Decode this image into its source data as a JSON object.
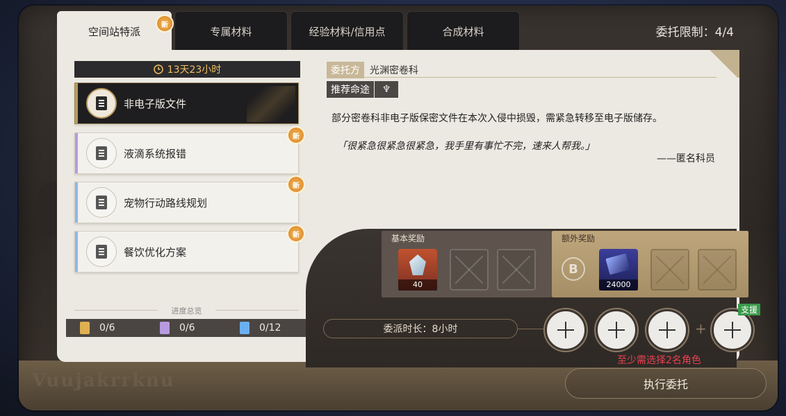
{
  "tabs": [
    {
      "label": "空间站特派",
      "badge": "新"
    },
    {
      "label": "专属材料"
    },
    {
      "label": "经验材料/信用点"
    },
    {
      "label": "合成材料"
    }
  ],
  "limit": "委托限制：4/4",
  "timer": "13天23小时",
  "tasks": [
    {
      "label": "非电子版文件"
    },
    {
      "label": "液滴系统报错",
      "badge": "新"
    },
    {
      "label": "宠物行动路线规划",
      "badge": "新"
    },
    {
      "label": "餐饮优化方案",
      "badge": "新"
    }
  ],
  "progress": {
    "title": "进度总览",
    "items": [
      "0/6",
      "0/6",
      "0/12"
    ]
  },
  "detail": {
    "client_tag": "委托方",
    "client_name": "光渊密卷科",
    "path_tag": "推荐命途",
    "description": "部分密卷科非电子版保密文件在本次入侵中损毁，需紧急转移至电子版储存。",
    "quote": "「很紧急很紧急很紧急，我手里有事忙不完，速来人帮我。」",
    "signature": "——匿名科员"
  },
  "rewards": {
    "basic_title": "基本奖励",
    "extra_title": "额外奖励",
    "basic_qty": "40",
    "extra_grade": "B",
    "extra_qty": "24000"
  },
  "duration": "委派时长：8小时",
  "support": "支援",
  "plus": "+",
  "warning": "至少需选择2名角色",
  "execute": "执行委托",
  "engraved": "Vuujakrrknu"
}
